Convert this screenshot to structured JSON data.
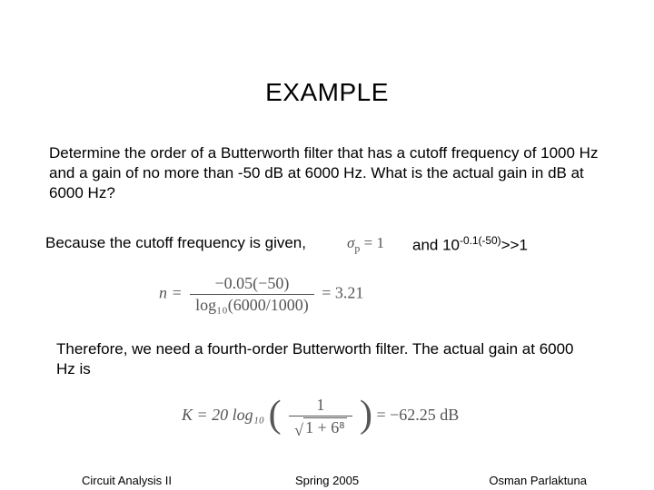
{
  "title": "EXAMPLE",
  "problem": "Determine the order of a Butterworth filter that has a cutoff frequency of 1000 Hz and a gain of no more than -50 dB at 6000 Hz. What is the actual gain in dB at 6000 Hz?",
  "given_text": "Because the cutoff frequency is given,",
  "sigma_eq": "σₚ = 1",
  "and_label": "and 10",
  "exp_text": "-0.1(-50)",
  "gg1": ">>1",
  "eq1": {
    "lhs": "n =",
    "num": "−0.05(−50)",
    "den": "log₁₀(6000/1000)",
    "rhs": "= 3.21"
  },
  "conclusion": "Therefore, we need a fourth-order Butterworth filter. The actual gain at 6000 Hz is",
  "eq2": {
    "lhs": "K = 20 log₁₀",
    "num": "1",
    "den_radicand": "1 + 6⁸",
    "rhs": "= −62.25 dB"
  },
  "footer": {
    "left": "Circuit Analysis II",
    "center": "Spring 2005",
    "right": "Osman Parlaktuna"
  }
}
